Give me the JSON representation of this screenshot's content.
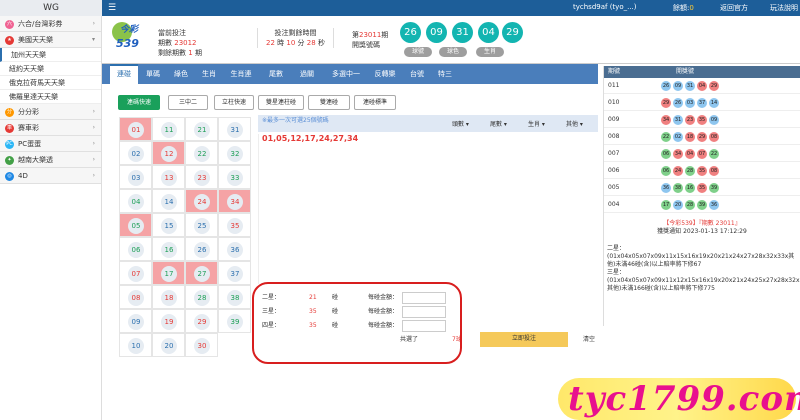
{
  "topbar": {
    "brand": "WG",
    "menu_icon": "hamburger-icon",
    "user": "tychsd9af (tyo_...)",
    "balance_label": "餘額:",
    "balance_value": "0",
    "back": "返回官方",
    "rules": "玩法說明",
    "bg_color": "#1d5e99"
  },
  "sidebar": {
    "sections": [
      {
        "label": "六合/台灣彩券",
        "icon": "lottery-icon",
        "color": "#f06292"
      },
      {
        "label": "美國天天樂",
        "icon": "flag-icon",
        "color": "#e53935",
        "items": [
          "加州天天樂",
          "紐約天天樂",
          "俄克拉荷馬天天樂",
          "佛羅里達天天樂"
        ]
      },
      {
        "label": "分分彩",
        "icon": "clock-icon",
        "color": "#ff9800"
      },
      {
        "label": "賽車彩",
        "icon": "car-icon",
        "color": "#e53935"
      },
      {
        "label": "PC蛋蛋",
        "icon": "egg-icon",
        "color": "#29b6f6"
      },
      {
        "label": "越南大樂透",
        "icon": "star-icon",
        "color": "#43a047"
      },
      {
        "label": "4D",
        "icon": "globe-icon",
        "color": "#1e88e5"
      }
    ]
  },
  "game_header": {
    "logo_top": "今彩",
    "logo_bottom": "539",
    "prev_label": "當前投注",
    "issue_label": "期數",
    "issue_number": "23012",
    "remaining_label": "剩餘期數",
    "remaining_count": "1",
    "remaining_unit": "期",
    "bet_time_label": "投注剩餘時間",
    "time_h": "22",
    "time_h_unit": "時",
    "time_m": "10",
    "time_m_unit": "分",
    "time_s": "28",
    "time_s_unit": "秒",
    "draw_prefix": "第",
    "draw_issue": "23011",
    "draw_suffix": "期",
    "draw_label": "開獎號碼",
    "draw_balls": [
      "26",
      "09",
      "31",
      "04",
      "29"
    ],
    "pills": [
      "球號",
      "球色",
      "生肖"
    ],
    "ball_color": "#13b5b1"
  },
  "tabs": [
    "連碰",
    "單碼",
    "綠色",
    "生肖",
    "生肖連",
    "尾數",
    "過關",
    "多選中一",
    "反轉樂",
    "台號",
    "特三"
  ],
  "sub_buttons": [
    "連碼快速",
    "三中二",
    "立柱快速",
    "雙星連柱碰",
    "雙連碰",
    "連碰標準"
  ],
  "numbers": [
    {
      "n": "01",
      "sel": true,
      "c": "r"
    },
    {
      "n": "02",
      "sel": false,
      "c": "b"
    },
    {
      "n": "03",
      "sel": false,
      "c": "b"
    },
    {
      "n": "04",
      "sel": false,
      "c": "g"
    },
    {
      "n": "05",
      "sel": true,
      "c": "g"
    },
    {
      "n": "06",
      "sel": false,
      "c": "g"
    },
    {
      "n": "07",
      "sel": false,
      "c": "r"
    },
    {
      "n": "08",
      "sel": false,
      "c": "r"
    },
    {
      "n": "09",
      "sel": false,
      "c": "b"
    },
    {
      "n": "10",
      "sel": false,
      "c": "b"
    },
    {
      "n": "11",
      "sel": false,
      "c": "g"
    },
    {
      "n": "12",
      "sel": true,
      "c": "r"
    },
    {
      "n": "13",
      "sel": false,
      "c": "r"
    },
    {
      "n": "14",
      "sel": false,
      "c": "b"
    },
    {
      "n": "15",
      "sel": false,
      "c": "b"
    },
    {
      "n": "16",
      "sel": false,
      "c": "g"
    },
    {
      "n": "17",
      "sel": true,
      "c": "g"
    },
    {
      "n": "18",
      "sel": false,
      "c": "r"
    },
    {
      "n": "19",
      "sel": false,
      "c": "r"
    },
    {
      "n": "20",
      "sel": false,
      "c": "b"
    },
    {
      "n": "21",
      "sel": false,
      "c": "g"
    },
    {
      "n": "22",
      "sel": false,
      "c": "g"
    },
    {
      "n": "23",
      "sel": false,
      "c": "r"
    },
    {
      "n": "24",
      "sel": true,
      "c": "r"
    },
    {
      "n": "25",
      "sel": false,
      "c": "b"
    },
    {
      "n": "26",
      "sel": false,
      "c": "b"
    },
    {
      "n": "27",
      "sel": true,
      "c": "g"
    },
    {
      "n": "28",
      "sel": false,
      "c": "g"
    },
    {
      "n": "29",
      "sel": false,
      "c": "r"
    },
    {
      "n": "30",
      "sel": false,
      "c": "r"
    },
    {
      "n": "31",
      "sel": false,
      "c": "b"
    },
    {
      "n": "32",
      "sel": false,
      "c": "g"
    },
    {
      "n": "33",
      "sel": false,
      "c": "g"
    },
    {
      "n": "34",
      "sel": true,
      "c": "r"
    },
    {
      "n": "35",
      "sel": false,
      "c": "r"
    },
    {
      "n": "36",
      "sel": false,
      "c": "b"
    },
    {
      "n": "37",
      "sel": false,
      "c": "b"
    },
    {
      "n": "38",
      "sel": false,
      "c": "g"
    },
    {
      "n": "39",
      "sel": false,
      "c": "g"
    }
  ],
  "info_bar": {
    "text": "※最多一次可選25個號碼",
    "dropdowns": [
      "頭數",
      "尾數",
      "生肖",
      "其他"
    ]
  },
  "picked": "01,05,12,17,24,27,34",
  "bets": [
    {
      "label": "二星：",
      "count": "21",
      "unit": "碰",
      "money_label": "每碰金額："
    },
    {
      "label": "三星：",
      "count": "35",
      "unit": "碰",
      "money_label": "每碰金額："
    },
    {
      "label": "四星：",
      "count": "35",
      "unit": "碰",
      "money_label": "每碰金額："
    }
  ],
  "summary": {
    "text": "共選了",
    "count": "7球",
    "confirm": "立即投注",
    "clear": "清空"
  },
  "history": {
    "col1": "期號",
    "col2": "開獎號",
    "rows": [
      {
        "issue": "011",
        "balls": [
          [
            "26",
            "blue"
          ],
          [
            "09",
            "blue"
          ],
          [
            "31",
            "blue"
          ],
          [
            "04",
            "red"
          ],
          [
            "29",
            "red"
          ]
        ]
      },
      {
        "issue": "010",
        "balls": [
          [
            "29",
            "red"
          ],
          [
            "26",
            "blue"
          ],
          [
            "03",
            "blue"
          ],
          [
            "37",
            "blue"
          ],
          [
            "14",
            "blue"
          ]
        ]
      },
      {
        "issue": "009",
        "balls": [
          [
            "34",
            "red"
          ],
          [
            "31",
            "blue"
          ],
          [
            "23",
            "red"
          ],
          [
            "35",
            "red"
          ],
          [
            "09",
            "blue"
          ]
        ]
      },
      {
        "issue": "008",
        "balls": [
          [
            "22",
            "green"
          ],
          [
            "02",
            "blue"
          ],
          [
            "18",
            "red"
          ],
          [
            "29",
            "red"
          ],
          [
            "08",
            "red"
          ]
        ]
      },
      {
        "issue": "007",
        "balls": [
          [
            "06",
            "green"
          ],
          [
            "34",
            "red"
          ],
          [
            "04",
            "red"
          ],
          [
            "07",
            "red"
          ],
          [
            "22",
            "green"
          ]
        ]
      },
      {
        "issue": "006",
        "balls": [
          [
            "06",
            "green"
          ],
          [
            "24",
            "red"
          ],
          [
            "28",
            "green"
          ],
          [
            "35",
            "red"
          ],
          [
            "08",
            "red"
          ]
        ]
      },
      {
        "issue": "005",
        "balls": [
          [
            "36",
            "blue"
          ],
          [
            "38",
            "green"
          ],
          [
            "16",
            "green"
          ],
          [
            "35",
            "red"
          ],
          [
            "39",
            "green"
          ]
        ]
      },
      {
        "issue": "004",
        "balls": [
          [
            "17",
            "green"
          ],
          [
            "20",
            "blue"
          ],
          [
            "28",
            "green"
          ],
          [
            "39",
            "green"
          ],
          [
            "36",
            "blue"
          ]
        ]
      }
    ]
  },
  "notice": {
    "title": "【今彩539】『期數 23011』",
    "date": "獲獎通知 2023-01-13 17:12:29",
    "text1": "二星：(01x04x05x07x09x11x15x16x19x20x21x24x27x28x32x33x其他)未滿46碰(含)以上賠率將下修67",
    "text2": "三星：(01x04x05x07x09x11x12x15x16x19x20x21x24x25x27x28x32x33x其他)未滿166碰(含)以上賠率將下修775"
  },
  "watermark": "tyc1799.com"
}
